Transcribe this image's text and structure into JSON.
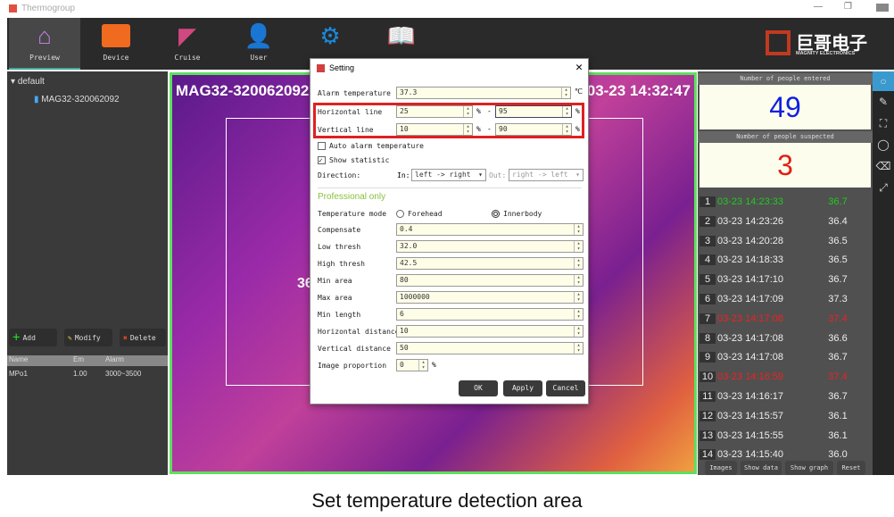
{
  "window": {
    "title": "Thermogroup"
  },
  "toolbar": {
    "tabs": [
      {
        "label": "Preview"
      },
      {
        "label": "Device"
      },
      {
        "label": "Cruise"
      },
      {
        "label": "User"
      },
      {
        "label": ""
      },
      {
        "label": ""
      }
    ],
    "logo_cn": "巨哥电子",
    "logo_en": "MAGNITY ELECTRONICS"
  },
  "left": {
    "group": "default",
    "device": "MAG32-320062092",
    "buttons": {
      "add": "Add",
      "modify": "Modify",
      "delete": "Delete"
    },
    "table": {
      "headers": [
        "Name",
        "Em",
        "Alarm"
      ],
      "rows": [
        [
          "MPo1",
          "1.00",
          "3000~3500"
        ]
      ]
    }
  },
  "video": {
    "device": "MAG32-320062092",
    "timestamp": "03-23 14:32:47",
    "overlay_temp": "36"
  },
  "dialog": {
    "title": "Setting",
    "alarm_temperature": {
      "label": "Alarm temperature",
      "value": "37.3",
      "unit": "℃"
    },
    "horizontal_line": {
      "label": "Horizontal line",
      "from": "25",
      "to": "95",
      "unit": "%",
      "sep": "-"
    },
    "vertical_line": {
      "label": "Vertical line",
      "from": "10",
      "to": "90",
      "unit": "%",
      "sep": "-"
    },
    "auto_alarm": {
      "label": "Auto alarm temperature",
      "checked": false
    },
    "show_statistic": {
      "label": "Show statistic",
      "checked": true
    },
    "direction": {
      "label": "Direction:",
      "in_label": "In:",
      "in_value": "left -> right",
      "out_label": "Out:",
      "out_value": "right -> left"
    },
    "professional": "Professional only",
    "temperature_mode": {
      "label": "Temperature mode",
      "options": [
        "Forehead",
        "Innerbody"
      ],
      "selected": "Innerbody"
    },
    "fields": [
      {
        "label": "Compensate",
        "value": "0.4"
      },
      {
        "label": "Low thresh",
        "value": "32.0"
      },
      {
        "label": "High thresh",
        "value": "42.5"
      },
      {
        "label": "Min area",
        "value": "80"
      },
      {
        "label": "Max area",
        "value": "1000000"
      },
      {
        "label": "Min length",
        "value": "6"
      },
      {
        "label": "Horizontal distance",
        "value": "10"
      },
      {
        "label": "Vertical distance",
        "value": "50"
      }
    ],
    "image_proportion": {
      "label": "Image proportion",
      "value": "0",
      "unit": "%"
    },
    "buttons": {
      "ok": "OK",
      "apply": "Apply",
      "cancel": "Cancel"
    }
  },
  "stats": {
    "entered_label": "Number of people entered",
    "entered": "49",
    "suspected_label": "Number of people suspected",
    "suspected": "3"
  },
  "records": [
    {
      "n": "1",
      "time": "03-23 14:23:33",
      "temp": "36.7",
      "color": "#22c922"
    },
    {
      "n": "2",
      "time": "03-23 14:23:26",
      "temp": "36.4",
      "color": "#eeeeee"
    },
    {
      "n": "3",
      "time": "03-23 14:20:28",
      "temp": "36.5",
      "color": "#eeeeee"
    },
    {
      "n": "4",
      "time": "03-23 14:18:33",
      "temp": "36.5",
      "color": "#eeeeee"
    },
    {
      "n": "5",
      "time": "03-23 14:17:10",
      "temp": "36.7",
      "color": "#eeeeee"
    },
    {
      "n": "6",
      "time": "03-23 14:17:09",
      "temp": "37.3",
      "color": "#eeeeee"
    },
    {
      "n": "7",
      "time": "03-23 14:17:08",
      "temp": "37.4",
      "color": "#ee2222"
    },
    {
      "n": "8",
      "time": "03-23 14:17:08",
      "temp": "36.6",
      "color": "#eeeeee"
    },
    {
      "n": "9",
      "time": "03-23 14:17:08",
      "temp": "36.7",
      "color": "#eeeeee"
    },
    {
      "n": "10",
      "time": "03-23 14:16:59",
      "temp": "37.4",
      "color": "#ee2222"
    },
    {
      "n": "11",
      "time": "03-23 14:16:17",
      "temp": "36.7",
      "color": "#eeeeee"
    },
    {
      "n": "12",
      "time": "03-23 14:15:57",
      "temp": "36.1",
      "color": "#eeeeee"
    },
    {
      "n": "13",
      "time": "03-23 14:15:55",
      "temp": "36.1",
      "color": "#eeeeee"
    },
    {
      "n": "14",
      "time": "03-23 14:15:40",
      "temp": "36.0",
      "color": "#eeeeee"
    }
  ],
  "bottom_buttons": {
    "images": "Images",
    "show_data": "Show data",
    "show_graph": "Show graph",
    "reset": "Reset"
  },
  "caption": "Set temperature detection area"
}
